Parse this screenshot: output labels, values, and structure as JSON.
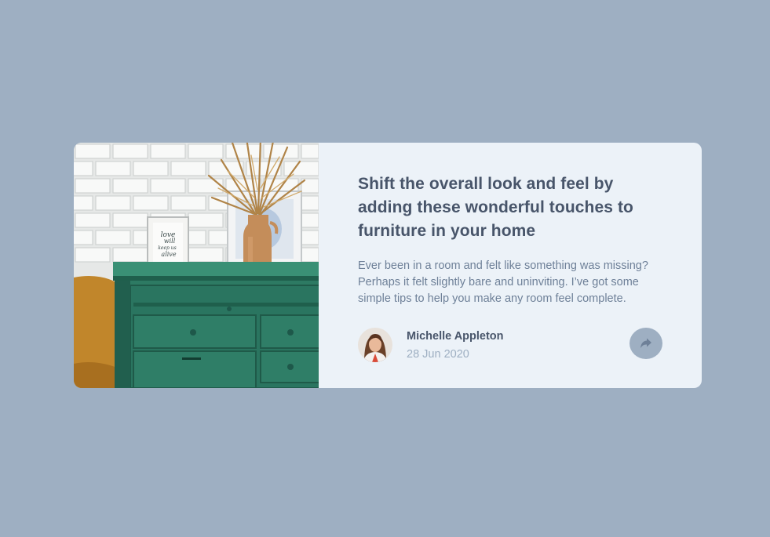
{
  "article": {
    "headline": "Shift the overall look and feel by adding these wonderful touches to furniture in your home",
    "excerpt": "Ever been in a room and felt like something was missing? Perhaps it felt slightly bare and uninviting. I’ve got some simple tips to help you make any room feel complete.",
    "image_icon": "drawers-photo",
    "image_frame_text": [
      "love",
      "will",
      "keep us",
      "alive"
    ]
  },
  "author": {
    "name": "Michelle Appleton",
    "date": "28 Jun 2020",
    "avatar_icon": "avatar-photo"
  },
  "share": {
    "icon": "share-icon"
  },
  "colors": {
    "page_bg": "#9eafc2",
    "card_bg": "#ecf2f8",
    "heading": "#48556a",
    "body_text": "#6e8098",
    "muted": "#9eafc2"
  }
}
